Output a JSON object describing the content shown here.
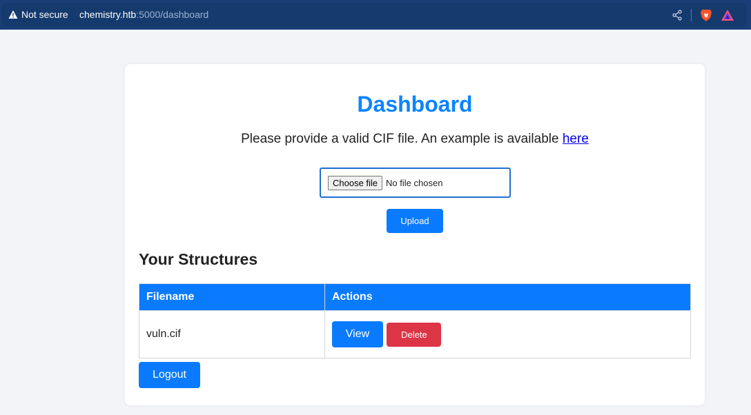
{
  "browser": {
    "security_label": "Not secure",
    "url_host": "chemistry.htb",
    "url_rest": ":5000/dashboard"
  },
  "icons": {
    "warning": "warning-triangle-icon",
    "share": "share-icon",
    "brave": "brave-lion-icon",
    "rewards": "brave-rewards-triangle-icon"
  },
  "colors": {
    "accent": "#0a7bff",
    "title": "#0a84ff",
    "danger": "#dc3545",
    "browser_bar": "#1a3f77"
  },
  "page": {
    "title": "Dashboard",
    "instructions": "Please provide a valid CIF file. An example is available ",
    "example_link": "here",
    "file_button": "Choose file",
    "file_status": "No file chosen",
    "upload_label": "Upload",
    "section_title": "Your Structures",
    "table": {
      "headers": [
        "Filename",
        "Actions"
      ],
      "rows": [
        {
          "filename": "vuln.cif",
          "view_label": "View",
          "delete_label": "Delete"
        }
      ]
    },
    "logout_label": "Logout"
  }
}
